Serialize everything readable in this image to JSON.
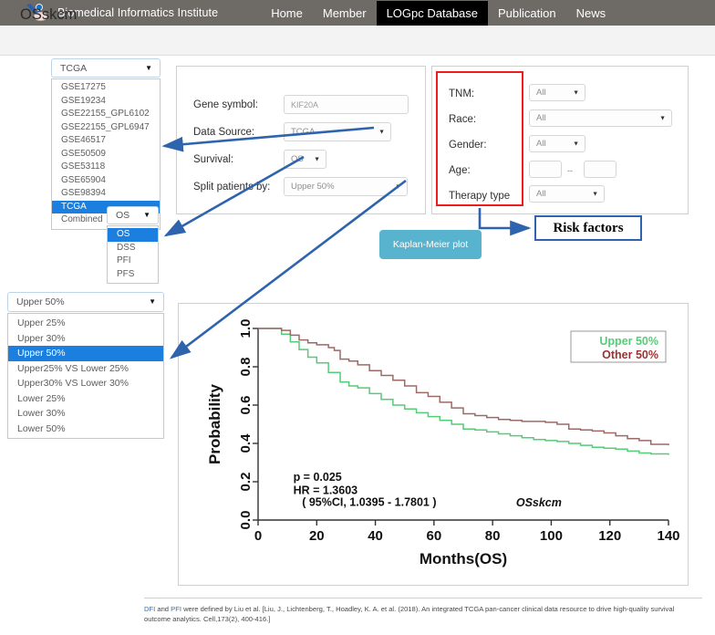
{
  "nav": {
    "brand": "Biomedical Informatics Institute",
    "logo_icon": "institute-logo-icon",
    "items": [
      {
        "label": "Home",
        "active": false
      },
      {
        "label": "Member",
        "active": false
      },
      {
        "label": "LOGpc Database",
        "active": true
      },
      {
        "label": "Publication",
        "active": false
      },
      {
        "label": "News",
        "active": false
      }
    ]
  },
  "page": {
    "title": "OSskcm"
  },
  "datasource_dropdown": {
    "value": "TCGA",
    "caret": "▼",
    "options": [
      "GSE17275",
      "GSE19234",
      "GSE22155_GPL6102",
      "GSE22155_GPL6947",
      "GSE46517",
      "GSE50509",
      "GSE53118",
      "GSE65904",
      "GSE98394",
      "TCGA",
      "Combined"
    ],
    "selected": "TCGA"
  },
  "survival_dropdown": {
    "value": "OS",
    "caret": "▼",
    "options": [
      "OS",
      "DSS",
      "PFI",
      "PFS"
    ],
    "selected": "OS"
  },
  "split_dropdown": {
    "value": "Upper 50%",
    "caret": "▼",
    "options": [
      "Upper 25%",
      "Upper 30%",
      "Upper 50%",
      "Upper25% VS Lower 25%",
      "Upper30% VS Lower 30%",
      "Lower 25%",
      "Lower 30%",
      "Lower 50%"
    ],
    "selected": "Upper 50%"
  },
  "form": {
    "gene_label": "Gene symbol:",
    "gene_value": "KIF20A",
    "datasource_label": "Data Source:",
    "datasource_value": "TCGA",
    "survival_label": "Survival:",
    "survival_value": "OS",
    "split_label": "Split patients by:",
    "split_value": "Upper 50%",
    "caret": "▼"
  },
  "risk_factors": {
    "tnm_label": "TNM:",
    "tnm_value": "All",
    "race_label": "Race:",
    "race_value": "All",
    "gender_label": "Gender:",
    "gender_value": "All",
    "age_label": "Age:",
    "age_min": "",
    "age_max": "",
    "age_separator": "--",
    "therapy_label": "Therapy type",
    "therapy_value": "All",
    "caret": "▼",
    "highlight_color": "#ee1c1c"
  },
  "annotations": {
    "km_button": "Kaplan-Meier plot",
    "risk_box": "Risk factors",
    "arrow_color": "#2e63ad",
    "km_button_color": "#58b3cf"
  },
  "chart_data": {
    "type": "line",
    "title": "",
    "xlabel": "Months(OS)",
    "ylabel": "Probability",
    "xlim": [
      0,
      140
    ],
    "ylim": [
      0.0,
      1.0
    ],
    "xticks": [
      0,
      20,
      40,
      60,
      80,
      100,
      120,
      140
    ],
    "yticks": [
      "0.0",
      "0.2",
      "0.4",
      "0.6",
      "0.8",
      "1.0"
    ],
    "grid": false,
    "legend_position": "top-right",
    "legend": [
      {
        "name": "Upper 50%",
        "color": "#55cc77"
      },
      {
        "name": "Other  50%",
        "color": "#993333"
      }
    ],
    "annotations": {
      "pvalue": "p = 0.025",
      "hr": "HR = 1.3603",
      "ci": "( 95%CI, 1.0395 - 1.7801 )",
      "cohort": "OSskcm"
    },
    "series": [
      {
        "name": "Upper 50%",
        "color": "#55cc77",
        "x": [
          0,
          4,
          8,
          11,
          14,
          17,
          20,
          24,
          28,
          31,
          34,
          38,
          42,
          46,
          50,
          54,
          58,
          62,
          66,
          70,
          74,
          78,
          82,
          86,
          90,
          94,
          98,
          102,
          106,
          110,
          114,
          118,
          122,
          126,
          130,
          134,
          140
        ],
        "y": [
          1.0,
          1.0,
          0.97,
          0.93,
          0.89,
          0.85,
          0.82,
          0.77,
          0.72,
          0.7,
          0.69,
          0.66,
          0.63,
          0.6,
          0.58,
          0.56,
          0.54,
          0.52,
          0.5,
          0.475,
          0.47,
          0.46,
          0.45,
          0.44,
          0.43,
          0.42,
          0.415,
          0.41,
          0.4,
          0.39,
          0.38,
          0.375,
          0.37,
          0.36,
          0.35,
          0.345,
          0.34
        ]
      },
      {
        "name": "Other  50%",
        "color": "#9c6a66",
        "x": [
          0,
          4,
          8,
          11,
          14,
          17,
          20,
          24,
          26,
          28,
          31,
          34,
          38,
          42,
          46,
          50,
          54,
          58,
          62,
          66,
          70,
          74,
          78,
          82,
          86,
          90,
          94,
          98,
          102,
          106,
          110,
          114,
          118,
          122,
          126,
          130,
          134,
          140
        ],
        "y": [
          1.0,
          1.0,
          0.99,
          0.965,
          0.94,
          0.925,
          0.915,
          0.9,
          0.885,
          0.84,
          0.83,
          0.81,
          0.78,
          0.755,
          0.73,
          0.7,
          0.665,
          0.645,
          0.615,
          0.585,
          0.555,
          0.545,
          0.535,
          0.525,
          0.52,
          0.515,
          0.515,
          0.51,
          0.5,
          0.475,
          0.47,
          0.465,
          0.455,
          0.44,
          0.425,
          0.415,
          0.395,
          0.39
        ]
      }
    ]
  },
  "footer": {
    "part1": "DFI",
    "part2": " and ",
    "part3": "PFI",
    "part4": " were defined by Liu et al. [Liu, J., Lichtenberg, T., Hoadley, K. A. et al. (2018). An integrated TCGA pan-cancer clinical data resource to drive high-quality survival outcome analytics. Cell,173(2), 400-416.]"
  }
}
